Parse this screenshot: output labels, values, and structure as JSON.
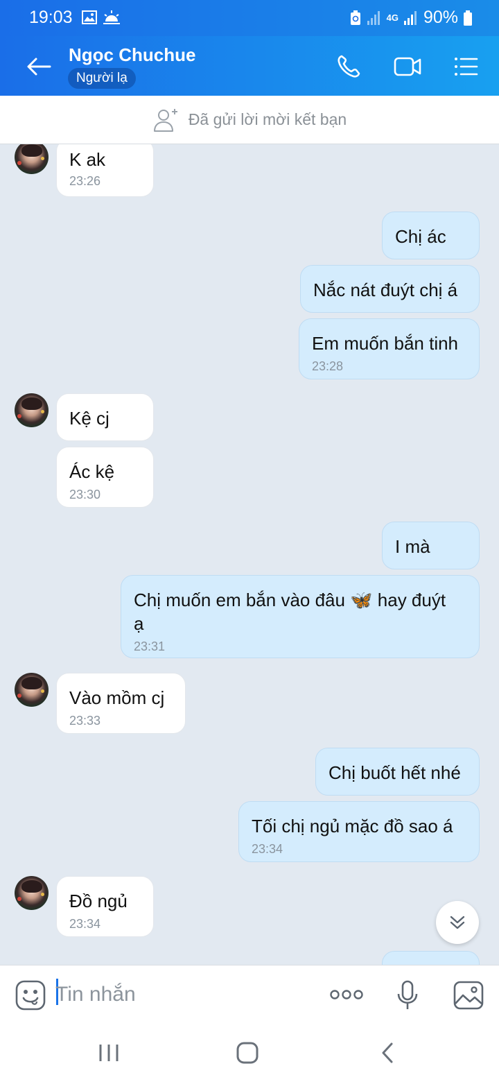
{
  "status_bar": {
    "time": "19:03",
    "network": "4G",
    "battery": "90%"
  },
  "header": {
    "name": "Ngọc Chuchue",
    "badge": "Người lạ"
  },
  "banner": {
    "text": "Đã gửi lời mời kết bạn"
  },
  "messages": [
    {
      "dir": "in",
      "lines": [
        "K ak"
      ],
      "time": "23:26"
    },
    {
      "dir": "out",
      "lines": [
        "Chị ác"
      ]
    },
    {
      "dir": "out",
      "lines": [
        "Nắc nát đuýt chị á"
      ]
    },
    {
      "dir": "out",
      "lines": [
        "Em muốn bắn tinh"
      ],
      "time": "23:28"
    },
    {
      "dir": "in",
      "lines": [
        "Kệ cj"
      ]
    },
    {
      "dir": "in",
      "lines": [
        "Ác kệ"
      ],
      "time": "23:30"
    },
    {
      "dir": "out",
      "lines": [
        "I mà"
      ]
    },
    {
      "dir": "out",
      "lines": [
        "Chị muốn em bắn vào đâu 🦋 hay đuýt",
        "ạ"
      ],
      "time": "23:31"
    },
    {
      "dir": "in",
      "lines": [
        "Vào mồm cj"
      ],
      "time": "23:33"
    },
    {
      "dir": "out",
      "lines": [
        "Chị buốt hết nhé"
      ]
    },
    {
      "dir": "out",
      "lines": [
        "Tối chị ngủ mặc đồ sao á"
      ],
      "time": "23:34"
    },
    {
      "dir": "in",
      "lines": [
        "Đồ ngủ"
      ],
      "time": "23:34"
    }
  ],
  "input": {
    "placeholder": "Tin nhắn"
  },
  "colors": {
    "header_start": "#1a6ee8",
    "header_end": "#18a0f0",
    "bubble_out": "#d4ecfd",
    "bubble_in": "#ffffff",
    "chat_bg": "#e2e9f1"
  }
}
